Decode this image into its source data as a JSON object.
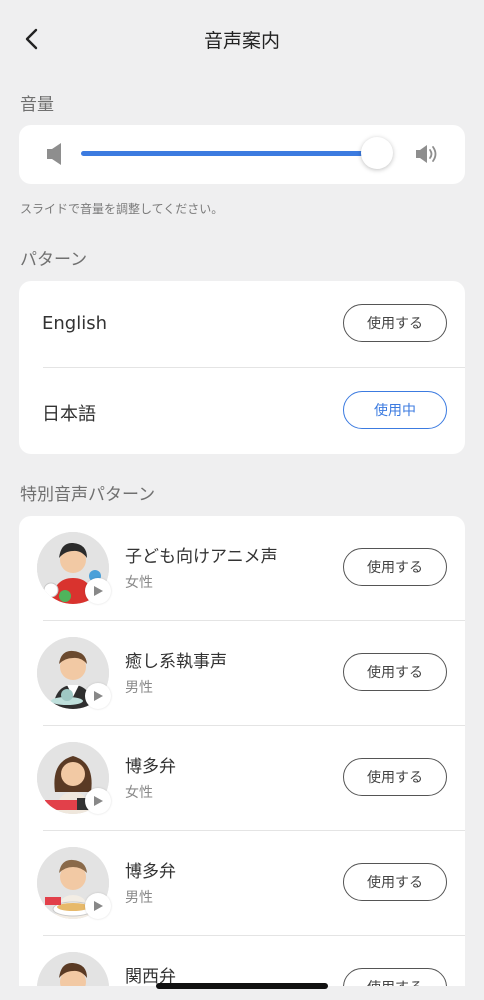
{
  "header": {
    "title": "音声案内",
    "back_icon": "chevron-left-icon"
  },
  "volume": {
    "section_label": "音量",
    "level": 0.96,
    "hint": "スライドで音量を調整してください。",
    "accent_color": "#3c7be0"
  },
  "pattern": {
    "section_label": "パターン",
    "items": [
      {
        "label": "English",
        "button": "使用する",
        "active": false
      },
      {
        "label": "日本語",
        "button": "使用中",
        "active": true
      }
    ]
  },
  "special": {
    "section_label": "特別音声パターン",
    "items": [
      {
        "title": "子ども向けアニメ声",
        "subtitle": "女性",
        "button": "使用する"
      },
      {
        "title": "癒し系執事声",
        "subtitle": "男性",
        "button": "使用する"
      },
      {
        "title": "博多弁",
        "subtitle": "女性",
        "button": "使用する"
      },
      {
        "title": "博多弁",
        "subtitle": "男性",
        "button": "使用する"
      },
      {
        "title": "関西弁",
        "subtitle": "",
        "button": "使用する"
      }
    ]
  }
}
